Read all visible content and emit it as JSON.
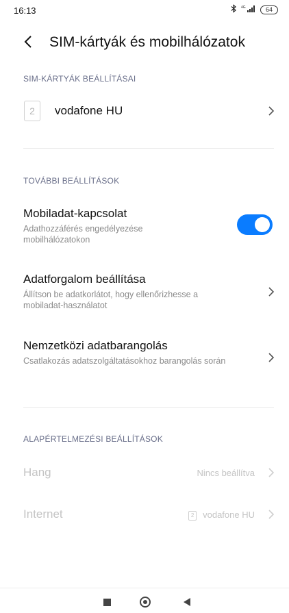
{
  "status_bar": {
    "time": "16:13",
    "battery": "64",
    "icons": [
      "bluetooth-icon",
      "signal-icon",
      "battery-icon"
    ]
  },
  "header": {
    "title": "SIM-kártyák és mobilhálózatok"
  },
  "sim_section": {
    "label": "SIM-KÁRTYÁK BEÁLLÍTÁSAI",
    "sim_slot": "2",
    "sim_name": "vodafone HU"
  },
  "more_section": {
    "label": "TOVÁBBI BEÁLLÍTÁSOK",
    "items": [
      {
        "title": "Mobiladat-kapcsolat",
        "subtitle": "Adathozzáférés engedélyezése mobilhálózatokon",
        "toggle_on": true
      },
      {
        "title": "Adatforgalom beállítása",
        "subtitle": "Állítson be adatkorlátot, hogy ellenőrizhesse a mobiladat-használatot"
      },
      {
        "title": "Nemzetközi adatbarangolás",
        "subtitle": "Csatlakozás adatszolgáltatásokhoz barangolás során"
      }
    ]
  },
  "default_section": {
    "label": "ALAPÉRTELMEZÉSI BEÁLLÍTÁSOK",
    "items": [
      {
        "title": "Hang",
        "value": "Nincs beállítva"
      },
      {
        "title": "Internet",
        "value": "vodafone HU",
        "slot": "2"
      }
    ]
  },
  "colors": {
    "accent": "#0a7cff",
    "section_label": "#6a6f8a",
    "disabled": "#c4c4c4"
  }
}
